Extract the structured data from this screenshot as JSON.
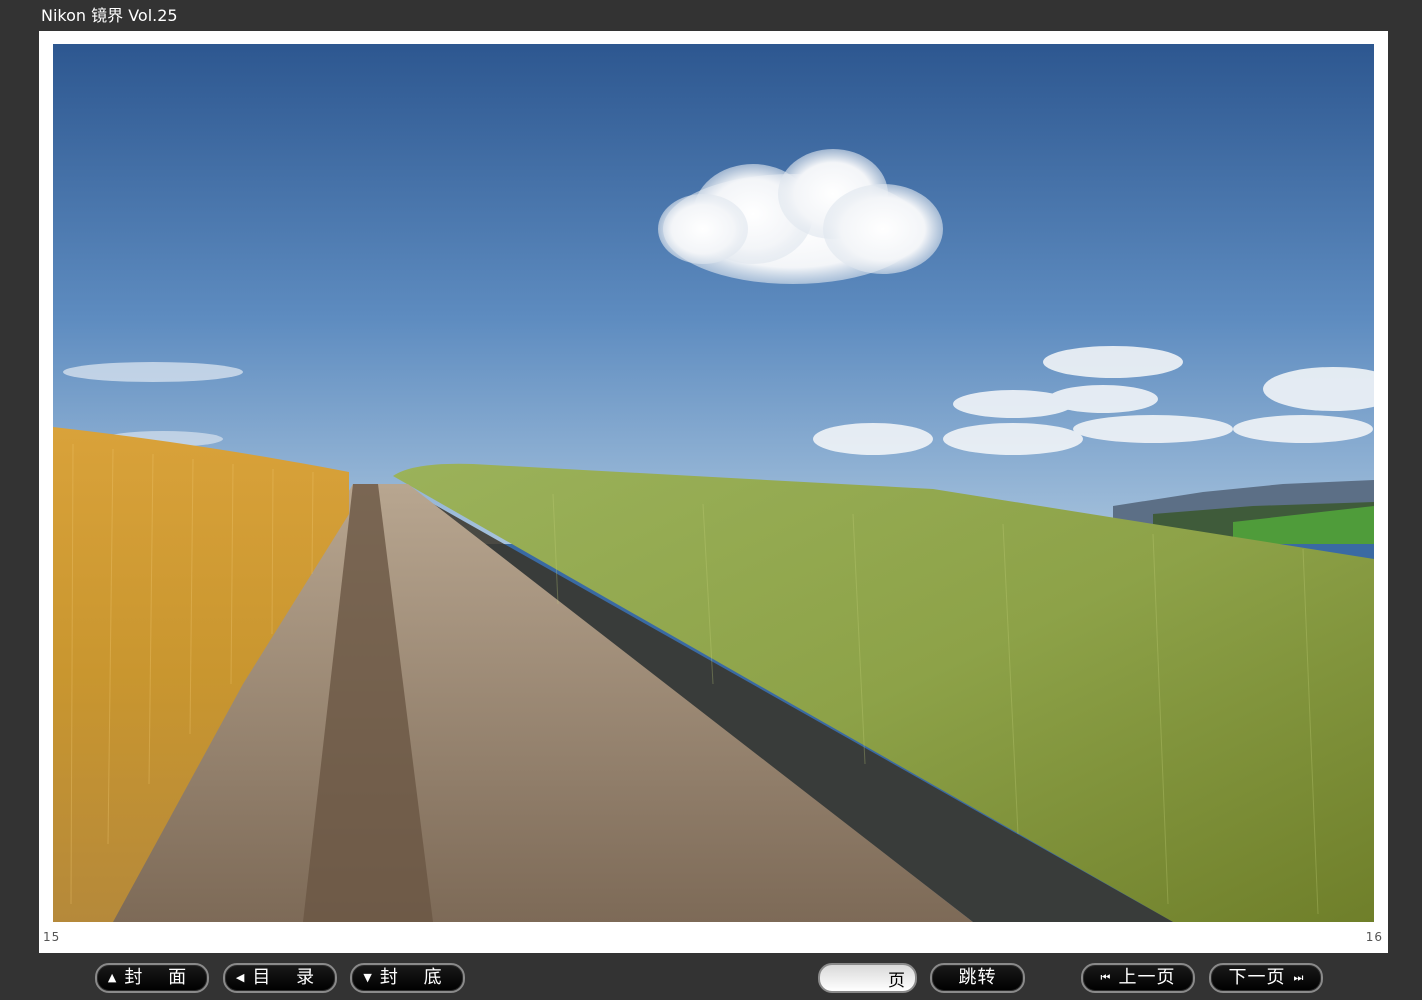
{
  "window": {
    "title": "Nikon 镜界 Vol.25"
  },
  "pages": {
    "left_number": "15",
    "right_number": "16"
  },
  "photo": {
    "description_icon": "landscape-photo",
    "colors": {
      "sky_top": "#2f5a94",
      "sky_bottom": "#8fb3d6",
      "wheat_left": "#c9972f",
      "wheat_right": "#7f9a3a",
      "path": "#8a7560"
    }
  },
  "toolbar": {
    "cover": {
      "icon": "triangle-up-icon",
      "glyph": "▲",
      "label": "封 面"
    },
    "contents": {
      "icon": "triangle-left-icon",
      "glyph": "◀",
      "label": "目 录"
    },
    "back_cover": {
      "icon": "triangle-down-icon",
      "glyph": "▼",
      "label": "封 底"
    },
    "page_input": {
      "value": "",
      "unit": "页"
    },
    "jump": {
      "label": "跳转"
    },
    "prev": {
      "icon": "skip-back-icon",
      "glyph": "⏮",
      "label": "上一页"
    },
    "next": {
      "icon": "skip-forward-icon",
      "glyph": "⏭",
      "label": "下一页"
    }
  }
}
